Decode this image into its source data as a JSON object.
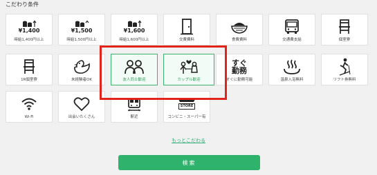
{
  "section_title": "こだわり条件",
  "tiles": [
    {
      "label": "時給1,400円以上",
      "icon": "coins-icon",
      "amount": "¥1,400",
      "selected": false
    },
    {
      "label": "時給1,500円以上",
      "icon": "coins-icon",
      "amount": "¥1,500",
      "selected": false
    },
    {
      "label": "時給1,600円以上",
      "icon": "coins-icon",
      "amount": "¥1,600",
      "selected": false
    },
    {
      "label": "交費費料",
      "icon": "door-icon",
      "selected": false
    },
    {
      "label": "食費費料",
      "icon": "rice-bowl-icon",
      "selected": false
    },
    {
      "label": "交通費支給",
      "icon": "bus-icon",
      "selected": false
    },
    {
      "label": "個室寮",
      "icon": "chair-icon",
      "selected": false
    },
    {
      "label": "1R個室寮",
      "icon": "chair-icon",
      "selected": false
    },
    {
      "label": "未経験者OK",
      "icon": "duck-icon",
      "selected": false
    },
    {
      "label": "友人同士歓迎",
      "icon": "friends-icon",
      "selected": true
    },
    {
      "label": "カップル歓迎",
      "icon": "couple-icon",
      "selected": true
    },
    {
      "label": "すぐに勤務可能",
      "icon": "sugu-kinmu-icon",
      "icon_text": [
        "すぐ",
        "勤務"
      ],
      "selected": false
    },
    {
      "label": "温泉入浴無料",
      "icon": "hot-spring-icon",
      "selected": false
    },
    {
      "label": "リフト券無料",
      "icon": "skier-icon",
      "selected": false
    },
    {
      "label": "Wi-Fi",
      "icon": "wifi-icon",
      "selected": false
    },
    {
      "label": "出会いたくさん",
      "icon": "heart-icon",
      "selected": false
    },
    {
      "label": "駅近",
      "icon": "train-icon",
      "selected": false
    },
    {
      "label": "コンビニ・スーパー有",
      "icon": "store-icon",
      "icon_text": "STORE",
      "selected": false
    }
  ],
  "more_link": "もっとこだわる",
  "search_button": "検索",
  "colors": {
    "accent": "#2fb26b",
    "highlight": "#e2231a"
  }
}
